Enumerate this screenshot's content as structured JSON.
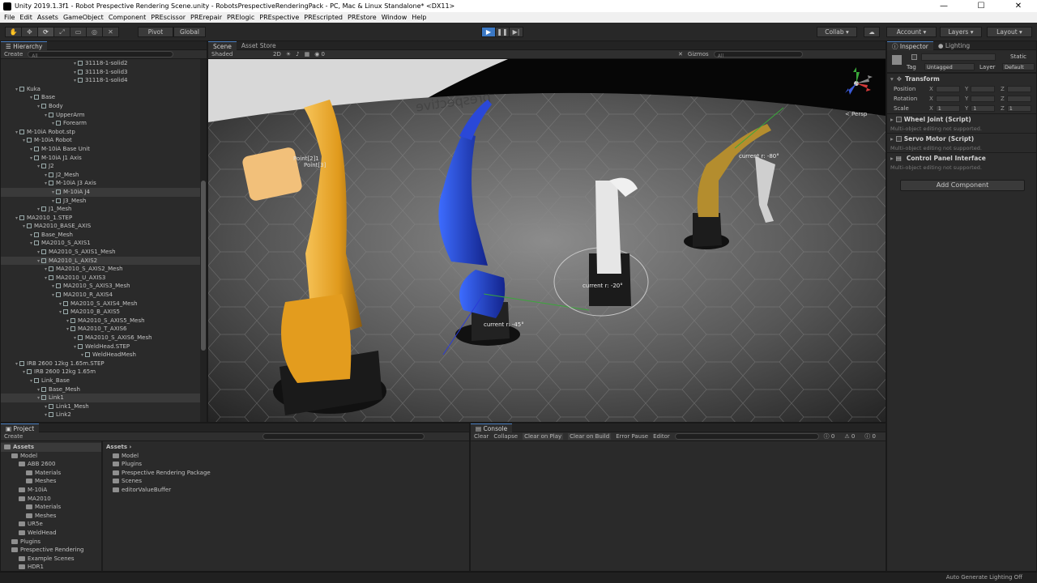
{
  "titlebar": {
    "title": "Unity 2019.1.3f1 - Robot Prespective Rendering Scene.unity - RobotsPrespectiveRenderingPack - PC, Mac & Linux Standalone* <DX11>",
    "minimize": "—",
    "maximize": "☐",
    "close": "✕"
  },
  "menu": [
    "File",
    "Edit",
    "Assets",
    "GameObject",
    "Component",
    "PREscissor",
    "PRErepair",
    "PRElogic",
    "PREspective",
    "PREscripted",
    "PREstore",
    "Window",
    "Help"
  ],
  "toolbar": {
    "pivot": "Pivot",
    "global": "Global",
    "collab": "Collab",
    "account": "Account",
    "layers": "Layers",
    "layout": "Layout"
  },
  "hierarchy": {
    "tab": "Hierarchy",
    "create": "Create",
    "search_placeholder": "All",
    "rows": [
      {
        "label": "31118-1-solid2",
        "indent": 10,
        "sel": false
      },
      {
        "label": "31118-1-solid3",
        "indent": 10,
        "sel": false
      },
      {
        "label": "31118-1-solid4",
        "indent": 10,
        "sel": false
      },
      {
        "label": "Kuka",
        "indent": 2,
        "sel": false
      },
      {
        "label": "Base",
        "indent": 4,
        "sel": false
      },
      {
        "label": "Body",
        "indent": 5,
        "sel": false
      },
      {
        "label": "UpperArm",
        "indent": 6,
        "sel": false
      },
      {
        "label": "Forearm",
        "indent": 7,
        "sel": false
      },
      {
        "label": "M-10iA Robot.stp",
        "indent": 2,
        "sel": false
      },
      {
        "label": "M-10iA Robot",
        "indent": 3,
        "sel": false
      },
      {
        "label": "M-10iA Base Unit",
        "indent": 4,
        "sel": false
      },
      {
        "label": "M-10iA J1 Axis",
        "indent": 4,
        "sel": false
      },
      {
        "label": "J2",
        "indent": 5,
        "sel": false
      },
      {
        "label": "J2_Mesh",
        "indent": 6,
        "sel": false
      },
      {
        "label": "M-10iA J3 Axis",
        "indent": 6,
        "sel": false
      },
      {
        "label": "M-10iA J4",
        "indent": 7,
        "sel": true
      },
      {
        "label": "J3_Mesh",
        "indent": 7,
        "sel": false
      },
      {
        "label": "J1_Mesh",
        "indent": 5,
        "sel": false
      },
      {
        "label": "MA2010_1.STEP",
        "indent": 2,
        "sel": false
      },
      {
        "label": "MA2010_BASE_AXIS",
        "indent": 3,
        "sel": false
      },
      {
        "label": "Base_Mesh",
        "indent": 4,
        "sel": false
      },
      {
        "label": "MA2010_S_AXIS1",
        "indent": 4,
        "sel": false
      },
      {
        "label": "MA2010_S_AXIS1_Mesh",
        "indent": 5,
        "sel": false
      },
      {
        "label": "MA2010_L_AXIS2",
        "indent": 5,
        "sel": true
      },
      {
        "label": "MA2010_S_AXIS2_Mesh",
        "indent": 6,
        "sel": false
      },
      {
        "label": "MA2010_U_AXIS3",
        "indent": 6,
        "sel": false
      },
      {
        "label": "MA2010_S_AXIS3_Mesh",
        "indent": 7,
        "sel": false
      },
      {
        "label": "MA2010_R_AXIS4",
        "indent": 7,
        "sel": false
      },
      {
        "label": "MA2010_S_AXIS4_Mesh",
        "indent": 8,
        "sel": false
      },
      {
        "label": "MA2010_B_AXIS5",
        "indent": 8,
        "sel": false
      },
      {
        "label": "MA2010_S_AXIS5_Mesh",
        "indent": 9,
        "sel": false
      },
      {
        "label": "MA2010_T_AXIS6",
        "indent": 9,
        "sel": false
      },
      {
        "label": "MA2010_S_AXIS6_Mesh",
        "indent": 10,
        "sel": false
      },
      {
        "label": "WeldHead.STEP",
        "indent": 10,
        "sel": false
      },
      {
        "label": "WeldHeadMesh",
        "indent": 11,
        "sel": false
      },
      {
        "label": "IRB 2600 12kg 1.65m.STEP",
        "indent": 2,
        "sel": false
      },
      {
        "label": "IRB 2600 12kg 1.65m",
        "indent": 3,
        "sel": false
      },
      {
        "label": "Link_Base",
        "indent": 4,
        "sel": false
      },
      {
        "label": "Base_Mesh",
        "indent": 5,
        "sel": false
      },
      {
        "label": "Link1",
        "indent": 5,
        "sel": true
      },
      {
        "label": "Link1_Mesh",
        "indent": 6,
        "sel": false
      },
      {
        "label": "Link2",
        "indent": 6,
        "sel": false
      }
    ]
  },
  "scene": {
    "tabs": [
      "Scene",
      "Asset Store"
    ],
    "shading": "Shaded",
    "mode2d": "2D",
    "gizmos": "Gizmos",
    "search_placeholder": "All",
    "persp": "< Persp",
    "floor_text": "prespective",
    "labels": {
      "point1": "Point[2]1",
      "point2": "Point[3]",
      "angle_blue": "current r: -45°",
      "angle_white": "current r: -20°",
      "angle_gold": "current r: -80°"
    }
  },
  "inspector": {
    "tabs": [
      "Inspector",
      "Lighting"
    ],
    "static": "Static",
    "tag_label": "Tag",
    "tag_value": "Untagged",
    "layer_label": "Layer",
    "layer_value": "Default",
    "transform": "Transform",
    "position": "Position",
    "rotation": "Rotation",
    "scale": "Scale",
    "scale_values": [
      "1",
      "1",
      "1"
    ],
    "components": [
      {
        "name": "Wheel Joint (Script)",
        "note": "Multi-object editing not supported."
      },
      {
        "name": "Servo Motor (Script)",
        "note": "Multi-object editing not supported."
      },
      {
        "name": "Control Panel Interface",
        "note": "Multi-object editing not supported."
      }
    ],
    "add_component": "Add Component"
  },
  "project": {
    "tab": "Project",
    "create": "Create",
    "tree": [
      {
        "label": "Assets",
        "indent": 0,
        "bold": true
      },
      {
        "label": "Model",
        "indent": 1
      },
      {
        "label": "ABB 2600",
        "indent": 2
      },
      {
        "label": "Materials",
        "indent": 3
      },
      {
        "label": "Meshes",
        "indent": 3
      },
      {
        "label": "M-10iA",
        "indent": 2
      },
      {
        "label": "MA2010",
        "indent": 2
      },
      {
        "label": "Materials",
        "indent": 3
      },
      {
        "label": "Meshes",
        "indent": 3
      },
      {
        "label": "UR5e",
        "indent": 2
      },
      {
        "label": "WeldHead",
        "indent": 2
      },
      {
        "label": "Plugins",
        "indent": 1
      },
      {
        "label": "Prespective Rendering",
        "indent": 1
      },
      {
        "label": "Example Scenes",
        "indent": 2
      },
      {
        "label": "HDR1",
        "indent": 2
      }
    ],
    "breadcrumb": "Assets",
    "assets": [
      "Model",
      "Plugins",
      "Prespective Rendering Package",
      "Scenes",
      "editorValueBuffer"
    ]
  },
  "console": {
    "tab": "Console",
    "buttons": [
      "Clear",
      "Collapse",
      "Clear on Play",
      "Clear on Build",
      "Error Pause",
      "Editor"
    ],
    "counts": [
      "0",
      "0",
      "0"
    ]
  },
  "status": {
    "text": "Auto Generate Lighting Off"
  },
  "colors": {
    "accent": "#3b78c4",
    "orange_robot": "#e3a024",
    "blue_robot": "#1f3fd0",
    "gold_robot": "#b08a2a"
  }
}
